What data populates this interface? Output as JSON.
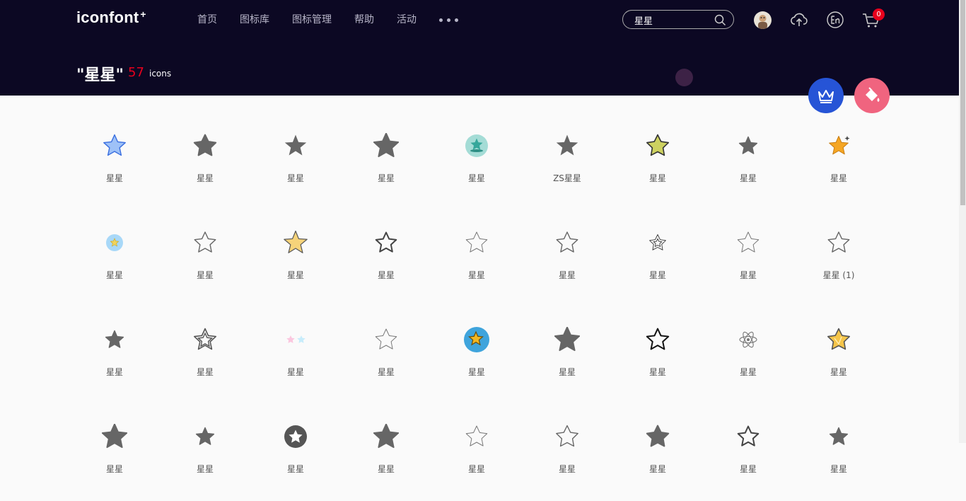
{
  "header": {
    "logo": "iconfont",
    "logo_mark": "+",
    "nav": [
      "首页",
      "图标库",
      "图标管理",
      "帮助",
      "活动"
    ],
    "search_value": "星星",
    "cart_count": "0"
  },
  "colors": {
    "header_bg": "#0c0823",
    "accent_red": "#e7001d",
    "crown_fab": "#2654d6",
    "paint_fab": "#f0647f"
  },
  "result": {
    "title": "\"星星\"",
    "count": "57",
    "unit": "icons"
  },
  "icons": [
    {
      "name": "星星",
      "style": "blue-outline"
    },
    {
      "name": "星星",
      "style": "gray-solid"
    },
    {
      "name": "星星",
      "style": "gray-solid-sharp"
    },
    {
      "name": "星星",
      "style": "gray-solid-big"
    },
    {
      "name": "星星",
      "style": "teal-circle"
    },
    {
      "name": "ZS星星",
      "style": "gray-solid-sharp"
    },
    {
      "name": "星星",
      "style": "olive-rounded"
    },
    {
      "name": "星星",
      "style": "gray-solid-small"
    },
    {
      "name": "星星",
      "style": "orange-sparkle"
    },
    {
      "name": "星星",
      "style": "blue-circle-star"
    },
    {
      "name": "星星",
      "style": "gray-outline"
    },
    {
      "name": "星星",
      "style": "yellow-outline"
    },
    {
      "name": "星星",
      "style": "dark-outline"
    },
    {
      "name": "星星",
      "style": "thin-outline"
    },
    {
      "name": "星星",
      "style": "gray-outline"
    },
    {
      "name": "星星",
      "style": "double-outline-small"
    },
    {
      "name": "星星",
      "style": "thin-outline"
    },
    {
      "name": "星星 (1)",
      "style": "gray-outline"
    },
    {
      "name": "星星",
      "style": "gray-solid-small"
    },
    {
      "name": "星星",
      "style": "double-outline"
    },
    {
      "name": "星星",
      "style": "pastel-pair"
    },
    {
      "name": "星星",
      "style": "thin-outline"
    },
    {
      "name": "星星",
      "style": "blue-circle-gold"
    },
    {
      "name": "星星",
      "style": "gray-solid-big"
    },
    {
      "name": "星星",
      "style": "black-outline"
    },
    {
      "name": "星星",
      "style": "atom"
    },
    {
      "name": "星星",
      "style": "gold-solid"
    },
    {
      "name": "星星",
      "style": "gray-solid-big"
    },
    {
      "name": "星星",
      "style": "gray-solid-small"
    },
    {
      "name": "星星",
      "style": "circle-star"
    },
    {
      "name": "星星",
      "style": "gray-solid-big"
    },
    {
      "name": "星星",
      "style": "thin-outline"
    },
    {
      "name": "星星",
      "style": "rounded-outline"
    },
    {
      "name": "星星",
      "style": "gray-solid"
    },
    {
      "name": "星星",
      "style": "dark-outline"
    },
    {
      "name": "星星",
      "style": "gray-solid-small"
    }
  ]
}
